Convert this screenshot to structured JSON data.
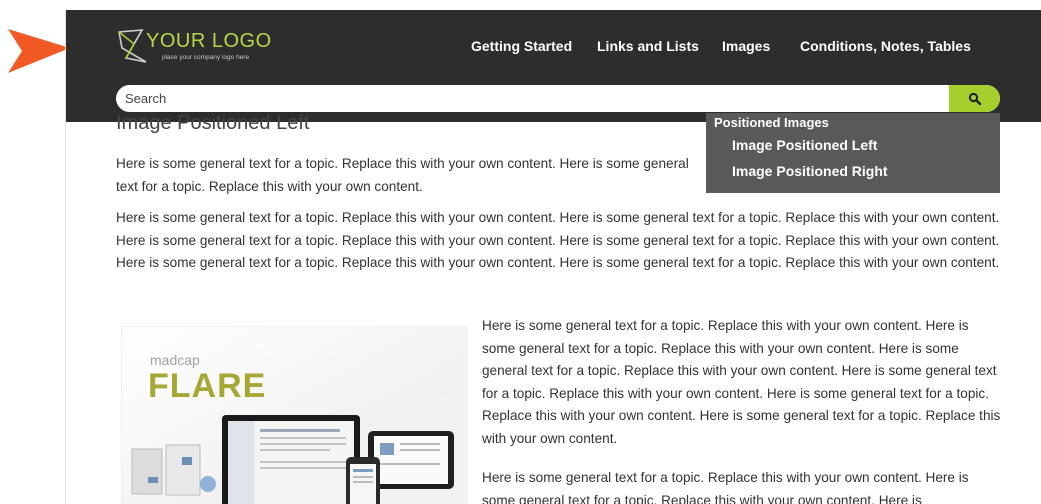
{
  "header": {
    "logo_text": "YOUR LOGO",
    "logo_sub": "place your company logo here",
    "nav": [
      "Getting Started",
      "Links and Lists",
      "Images",
      "Conditions, Notes, Tables"
    ]
  },
  "search": {
    "placeholder": "Search"
  },
  "menu": {
    "section": "Positioned Images",
    "items": [
      "Image Positioned Left",
      "Image Positioned Right"
    ]
  },
  "content": {
    "heading": "Image Positioned Left",
    "p1": "Here is some general text for a topic. Replace this with your own content. Here is some general text for a topic. Replace this with your own content.",
    "p2": "Here is some general text for a topic. Replace this with your own content. Here is some general text for a topic. Replace this with your own content. Here is some general text for a topic. Replace this with your own content. Here is some general text for a topic. Replace this with your own content. Here is some general text for a topic. Replace this with your own content. Here is some general text for a topic. Replace this with your own content.",
    "p3": "Here is some general text for a topic. Replace this with your own content. Here is some general text for a topic. Replace this with your own content. Here is some general text for a topic. Replace this with your own content. Here is some general text for a topic. Replace this with your own content. Here is some general text for a topic. Replace this with your own content. Here is some general text for a topic. Replace this with your own content.",
    "p4": "Here is some general text for a topic. Replace this with your own content. Here is some general text for a topic. Replace this with your own content. Here is"
  },
  "image": {
    "brand_small": "madcap",
    "brand_big": "FLARE"
  },
  "colors": {
    "accent": "#a4cf2d",
    "header": "#2d2d2d",
    "menu": "#595959",
    "pointer": "#f15a24"
  },
  "icons": {
    "pointer": "arrow-pointer-icon",
    "search": "search-icon",
    "logo": "logo-mark-icon"
  }
}
